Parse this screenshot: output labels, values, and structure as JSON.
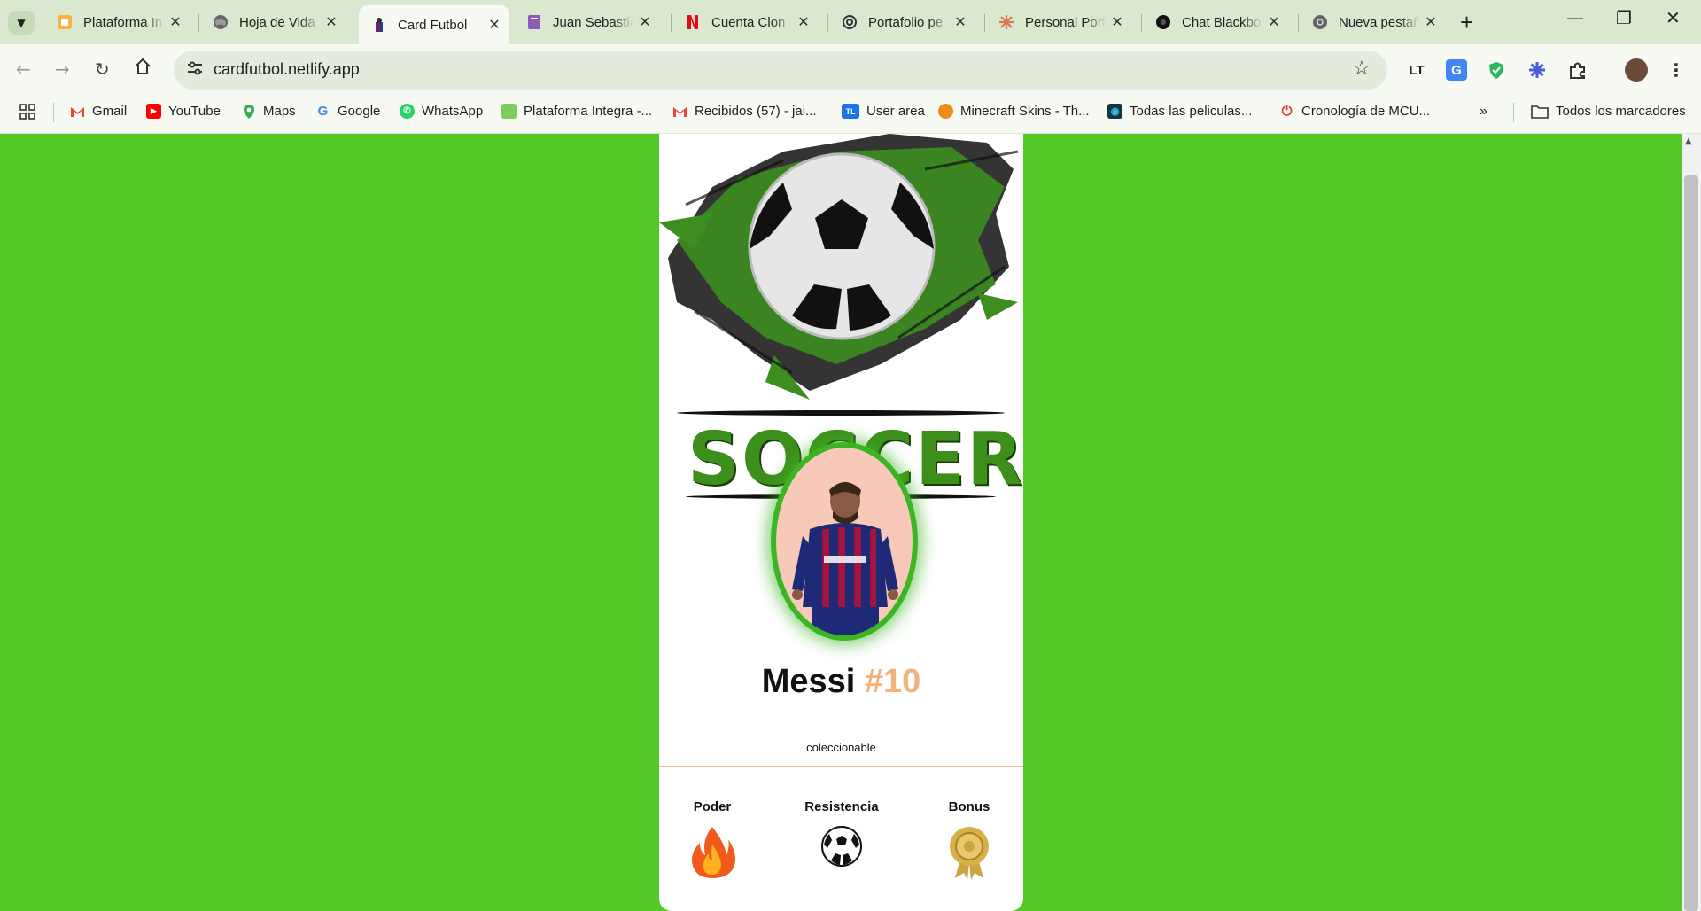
{
  "browser": {
    "tabs": [
      {
        "title": "Plataforma In",
        "icon": "plataforma-icon"
      },
      {
        "title": "Hoja de Vida",
        "icon": "globe-icon"
      },
      {
        "title": "Card Futbol",
        "icon": "card-futbol-icon",
        "active": true
      },
      {
        "title": "Juan Sebastia",
        "icon": "notebook-icon"
      },
      {
        "title": "Cuenta Clon",
        "icon": "netflix-icon"
      },
      {
        "title": "Portafolio pe",
        "icon": "openai-icon"
      },
      {
        "title": "Personal Port",
        "icon": "claude-icon"
      },
      {
        "title": "Chat Blackbo",
        "icon": "blackbox-icon"
      },
      {
        "title": "Nueva pestañ",
        "icon": "chrome-icon"
      }
    ],
    "url": "cardfutbol.netlify.app",
    "bookmarks": [
      {
        "label": "Gmail",
        "icon": "gmail-icon"
      },
      {
        "label": "YouTube",
        "icon": "youtube-icon"
      },
      {
        "label": "Maps",
        "icon": "maps-icon"
      },
      {
        "label": "Google",
        "icon": "google-icon"
      },
      {
        "label": "WhatsApp",
        "icon": "whatsapp-icon"
      },
      {
        "label": "Plataforma Integra -...",
        "icon": "plataforma-icon"
      },
      {
        "label": "Recibidos (57) - jai...",
        "icon": "gmail-icon"
      },
      {
        "label": "User area",
        "icon": "tl-icon"
      },
      {
        "label": "Minecraft Skins - Th...",
        "icon": "pumpkin-icon"
      },
      {
        "label": "Todas las peliculas...",
        "icon": "film-icon"
      },
      {
        "label": "Cronología de MCU...",
        "icon": "power-icon"
      }
    ],
    "all_bookmarks": "Todos los marcadores",
    "extensions": {
      "languagetool": "LT",
      "translate": "G"
    }
  },
  "card": {
    "banner_text": "SOCCER",
    "player_name": "Messi",
    "player_number": "#10",
    "subtitle": "coleccionable",
    "stats": [
      {
        "label": "Poder",
        "icon": "fire-icon"
      },
      {
        "label": "Resistencia",
        "icon": "soccer-ball-icon"
      },
      {
        "label": "Bonus",
        "icon": "medal-icon"
      }
    ],
    "colors": {
      "page_bg": "#52c927",
      "number": "#f2b27c",
      "frame": "#3cb522",
      "divider": "#f2b99a"
    }
  }
}
